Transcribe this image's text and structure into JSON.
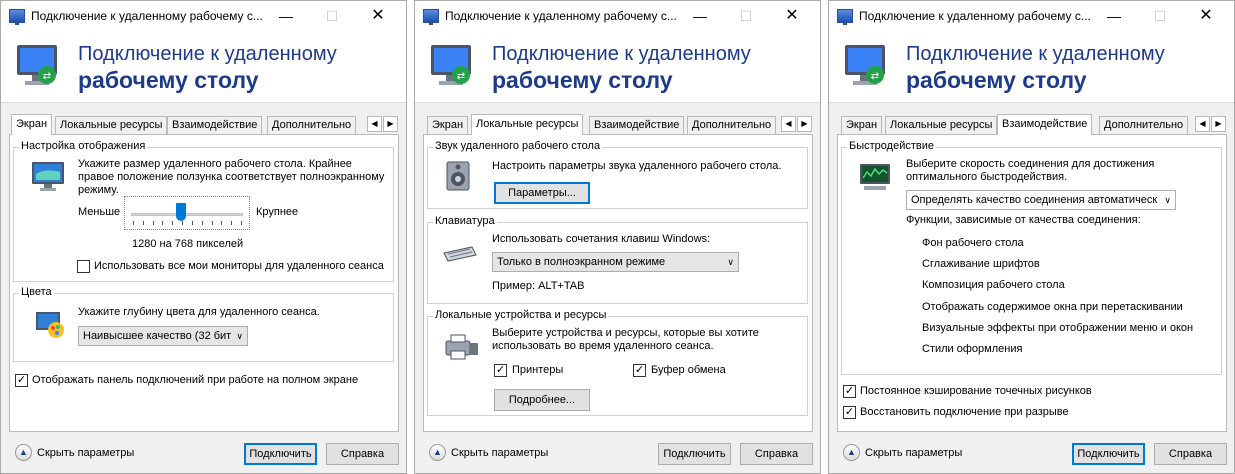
{
  "window_title": "Подключение к удаленному рабочему с...",
  "banner": {
    "line1": "Подключение к удаленному",
    "line2": "рабочему столу"
  },
  "tabs": [
    "Экран",
    "Локальные ресурсы",
    "Взаимодействие",
    "Дополнительно"
  ],
  "footer": {
    "hide_options": "Скрыть параметры",
    "connect": "Подключить",
    "help": "Справка"
  },
  "screen": {
    "display_group": "Настройка отображения",
    "display_text": "Укажите размер удаленного рабочего стола. Крайнее правое положение ползунка соответствует полноэкранному режиму.",
    "less": "Меньше",
    "more": "Крупнее",
    "resolution": "1280 на 768 пикселей",
    "slider_fraction": 0.45,
    "all_monitors": "Использовать все мои мониторы для удаленного сеанса",
    "colors_group": "Цвета",
    "colors_text": "Укажите глубину цвета для удаленного сеанса.",
    "color_depth": "Наивысшее качество (32 бит",
    "connection_bar": "Отображать панель подключений при работе на полном экране"
  },
  "resources": {
    "sound_group": "Звук удаленного рабочего стола",
    "sound_text": "Настроить параметры звука удаленного рабочего стола.",
    "params_button": "Параметры...",
    "keyboard_group": "Клавиатура",
    "keyboard_text": "Использовать сочетания клавиш Windows:",
    "keyboard_mode": "Только в полноэкранном режиме",
    "example": "Пример: ALT+TAB",
    "devices_group": "Локальные устройства и ресурсы",
    "devices_text": "Выберите устройства и ресурсы, которые вы хотите использовать во время удаленного сеанса.",
    "printers": "Принтеры",
    "clipboard": "Буфер обмена",
    "more_button": "Подробнее..."
  },
  "experience": {
    "perf_group": "Быстродействие",
    "perf_text": "Выберите скорость соединения для достижения оптимального быстродействия.",
    "speed_value": "Определять качество соединения автоматическ",
    "features_label": "Функции, зависимые от качества соединения:",
    "features": [
      "Фон рабочего стола",
      "Сглаживание шрифтов",
      "Композиция рабочего стола",
      "Отображать содержимое окна при перетаскивании",
      "Визуальные эффекты при отображении меню и окон",
      "Стили оформления"
    ],
    "bitmap_cache": "Постоянное кэширование точечных рисунков",
    "reconnect": "Восстановить подключение при разрыве"
  },
  "glyphs": {
    "minimize": "—",
    "maximize": "☐",
    "close": "✕",
    "check": "✓",
    "left": "◀",
    "right": "▶",
    "up": "▲",
    "down": "∨"
  },
  "colors": {
    "banner_text": "#1e3a8a",
    "accent": "#0078d7",
    "panel": "#f0f0f0"
  }
}
